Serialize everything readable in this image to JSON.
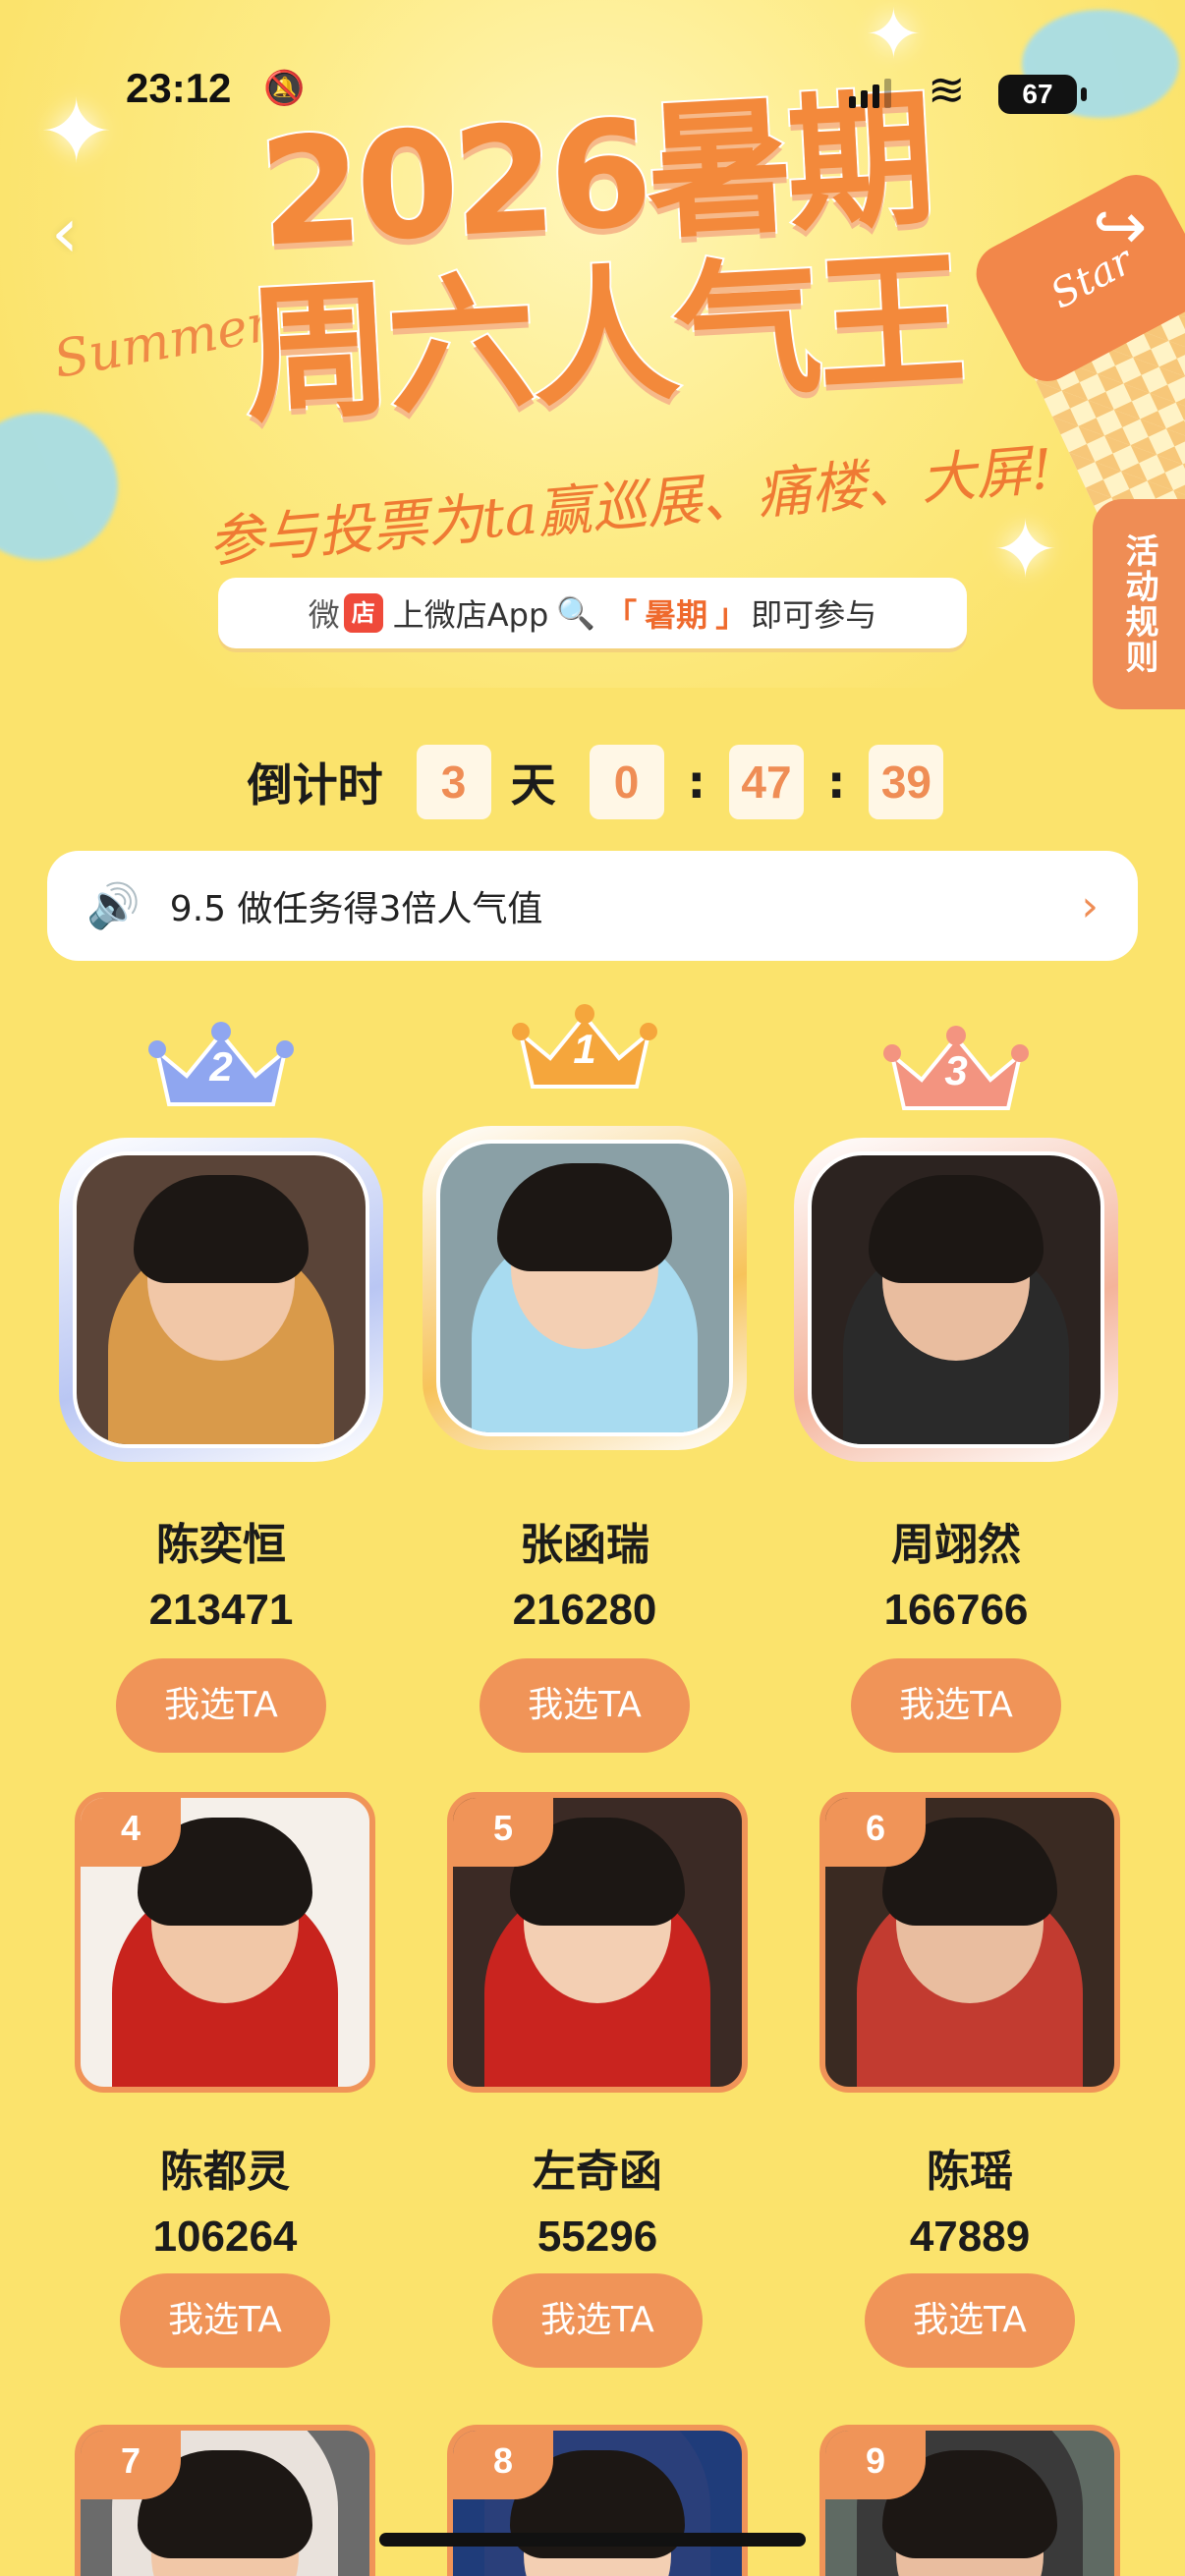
{
  "status_bar": {
    "time": "23:12",
    "battery": "67"
  },
  "banner": {
    "title_line1": "2026暑期",
    "title_line2": "周六人气王",
    "summer_script": "Summer",
    "star_label": "Star",
    "slogan": "参与投票为ta赢巡展、痛楼、大屏!",
    "search_hint": {
      "brand": "微",
      "badge": "店",
      "prefix": "上微店App",
      "keyword_open": "「",
      "keyword": "暑期",
      "keyword_close": "」",
      "suffix": "即可参与"
    },
    "rules_tab": "活动规则"
  },
  "countdown": {
    "label": "倒计时",
    "days": "3",
    "days_unit": "天",
    "hours": "0",
    "minutes": "47",
    "seconds": "39",
    "sep": ":"
  },
  "notice": {
    "text": "9.5 做任务得3倍人气值"
  },
  "vote_button_label": "我选TA",
  "podium": [
    {
      "rank": "2",
      "name": "陈奕恒",
      "votes": "213471",
      "frame_color": "#b9c6f3",
      "crown_color": "#8fa6f0"
    },
    {
      "rank": "1",
      "name": "张函瑞",
      "votes": "216280",
      "frame_color": "#f7c35a",
      "crown_color": "#f5a63c"
    },
    {
      "rank": "3",
      "name": "周翊然",
      "votes": "166766",
      "frame_color": "#f4b39a",
      "crown_color": "#f39480"
    }
  ],
  "grid": [
    {
      "rank": "4",
      "name": "陈都灵",
      "votes": "106264"
    },
    {
      "rank": "5",
      "name": "左奇函",
      "votes": "55296"
    },
    {
      "rank": "6",
      "name": "陈瑶",
      "votes": "47889"
    },
    {
      "rank": "7"
    },
    {
      "rank": "8"
    },
    {
      "rank": "9"
    }
  ],
  "colors": {
    "background": "#fbe36c",
    "accent": "#f09458",
    "title_orange": "#f3893b"
  }
}
